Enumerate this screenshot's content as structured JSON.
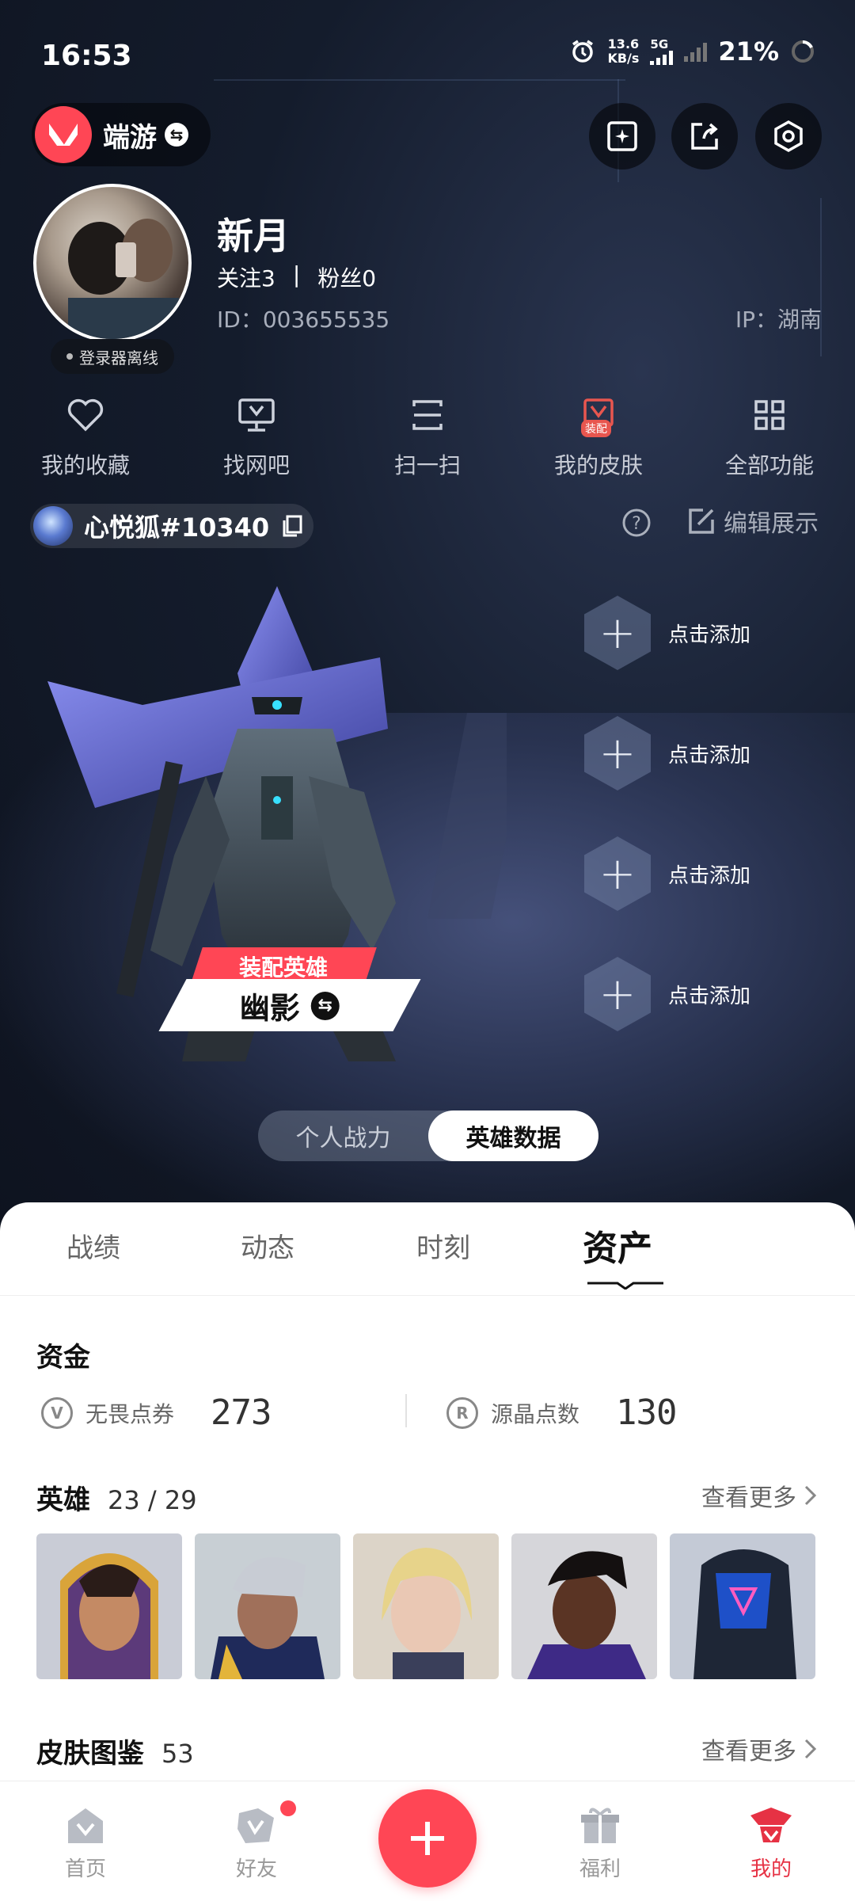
{
  "status_bar": {
    "time": "16:53",
    "net_speed_value": "13.6",
    "net_speed_unit": "KB/s",
    "network": "5G",
    "battery": "21%"
  },
  "header": {
    "app_name": "端游"
  },
  "profile": {
    "nickname": "新月",
    "following_label": "关注3",
    "followers_label": "粉丝0",
    "separator": "|",
    "id": "ID：003655535",
    "ip": "IP：湖南",
    "launcher_status": "登录器离线"
  },
  "quick_functions": [
    {
      "label": "我的收藏",
      "icon": "heart-icon"
    },
    {
      "label": "找网吧",
      "icon": "monitor-icon"
    },
    {
      "label": "扫一扫",
      "icon": "scan-icon"
    },
    {
      "label": "我的皮肤",
      "icon": "skin-icon",
      "badge": "装配"
    },
    {
      "label": "全部功能",
      "icon": "grid-icon"
    }
  ],
  "game_account": {
    "name": "心悦狐#10340",
    "edit_label": "编辑展示"
  },
  "agent": {
    "equip_label": "装配英雄",
    "name": "幽影"
  },
  "add_slots": [
    "点击添加",
    "点击添加",
    "点击添加",
    "点击添加"
  ],
  "toggle": {
    "options": [
      "个人战力",
      "英雄数据"
    ],
    "active": 1
  },
  "tabs": [
    {
      "label": "战绩"
    },
    {
      "label": "动态"
    },
    {
      "label": "时刻"
    },
    {
      "label": "资产"
    }
  ],
  "funds": {
    "title": "资金",
    "items": [
      {
        "label": "无畏点券",
        "value": "273",
        "icon": "valorant-points-icon"
      },
      {
        "label": "源晶点数",
        "value": "130",
        "icon": "radianite-icon"
      }
    ]
  },
  "heroes": {
    "title": "英雄",
    "count": "23 / 29",
    "see_more": "查看更多",
    "cards": [
      "hero-portrait-1",
      "hero-portrait-2",
      "hero-portrait-3",
      "hero-portrait-4",
      "hero-portrait-5"
    ]
  },
  "skins": {
    "title": "皮肤图鉴",
    "count": "53",
    "see_more": "查看更多"
  },
  "bottom_nav": [
    {
      "label": "首页",
      "icon": "home-icon"
    },
    {
      "label": "好友",
      "icon": "friends-icon"
    },
    {
      "label": "",
      "icon": "plus-icon"
    },
    {
      "label": "福利",
      "icon": "gift-icon"
    },
    {
      "label": "我的",
      "icon": "profile-icon"
    }
  ],
  "colors": {
    "accent": "#ff4655",
    "hero_bg": "#141c2c",
    "sheet_bg": "#ffffff"
  }
}
